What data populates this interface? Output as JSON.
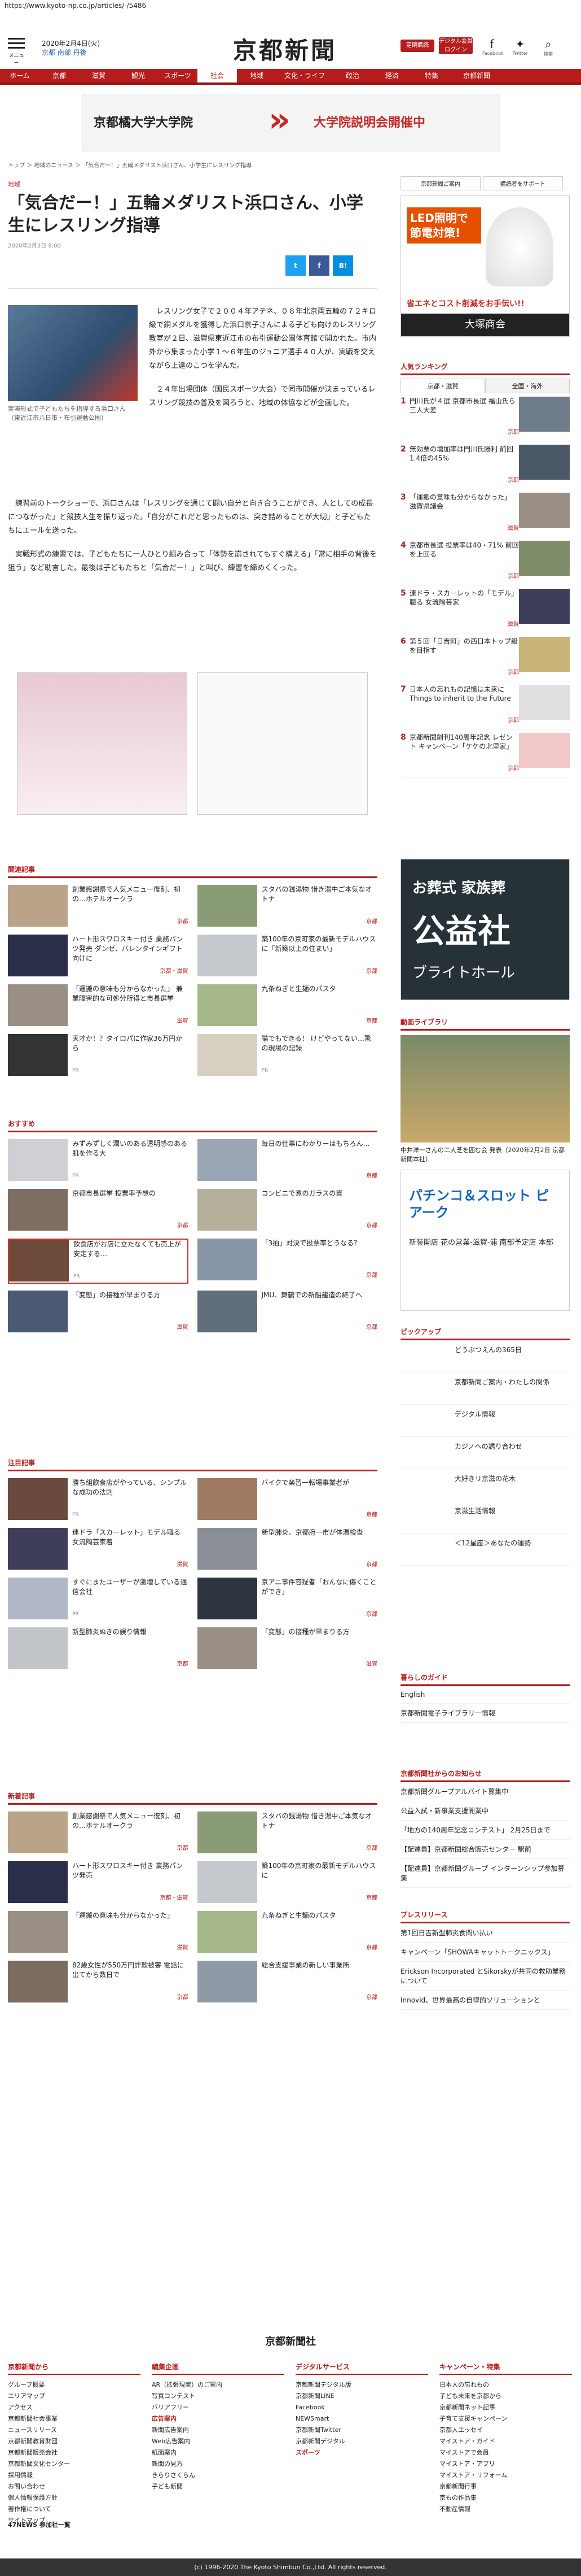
{
  "url": "https://www.kyoto-np.co.jp/articles/-/5486",
  "header": {
    "menu_label": "メニュー",
    "date": "2020年2月4日(火)",
    "weather_cities": [
      "京都",
      "南部",
      "丹後"
    ],
    "logo": "京都新聞",
    "buttons": [
      "定期購読",
      "デジタル会員ログイン"
    ],
    "social": [
      "Facebook",
      "Twitter",
      "検索"
    ]
  },
  "nav": [
    "ホーム",
    "京都",
    "滋賀",
    "観光",
    "スポーツ",
    "社会",
    "地域",
    "文化・ライフ",
    "政治",
    "経済",
    "特集",
    "京都新聞"
  ],
  "nav_active": "社会",
  "banner": {
    "left": "京都橘大学大学院",
    "right": "大学院説明会開催中"
  },
  "breadcrumb": "トップ ＞ 地域のニュース ＞ 「気合だー！」五輪メダリスト浜口さん、小学生にレスリング指導",
  "article": {
    "category": "地域",
    "title": "「気合だー！」五輪メダリスト浜口さん、小学生にレスリング指導",
    "date": "2020年2月3日 8:00",
    "share": [
      "t",
      "f",
      "B!"
    ],
    "caption": "実演形式で子どもたちを指導する浜口さん（東近江市八日市・布引運動公園）",
    "paragraphs": [
      "レスリング女子で２００４年アテネ、０８年北京両五輪の７２キロ級で銅メダルを獲得した浜口京子さんによる子ども向けのレスリング教室が２日、滋賀県東近江市の布引運動公園体育館で開かれた。市内外から集まった小学１～６年生のジュニア選手４０人が、実戦を交えながら上達のこつを学んだ。",
      "２４年出場団体（国民スポーツ大会）で同市開催が決まっているレスリング競技の普及を図ろうと、地域の体協などが企画した。",
      "練習前のトークショーで、浜口さんは「レスリングを通じて闘い自分と向き合うことができ、人としての成長につながった」と競技人生を振り返った。「自分がこれだと思ったものは、突き詰めることが大切」と子どもたちにエールを送った。",
      "実戦形式の練習では、子どもたちに一人ひとり組み合って「体勢を崩されてもすぐ構える」「常に相手の背後を狙う」など助言した。最後は子どもたちと「気合だー！」と叫び、練習を締めくくった。"
    ]
  },
  "sections": {
    "related": {
      "title": "関連記事",
      "items": [
        {
          "text": "創業感謝祭で人気メニュー復刻、初の…ホテルオークラ",
          "tag": "京都"
        },
        {
          "text": "スタバの銭湯物 惜き湯中ご本気なオトナ",
          "tag": "京都"
        },
        {
          "text": "ハート形スワロスキー付き 業務パンツ発売 ダンゼ、バレンタインギフト向けに",
          "tag": "京都・滋賀"
        },
        {
          "text": "築100年の京町家の最新モデルハウスに「新築以上の住まい」",
          "tag": "京都"
        },
        {
          "text": "「運搬の意味も分からなかった」 兼業障害的な可処分所得と市長選挙",
          "tag": "滋賀"
        },
        {
          "text": "九条ねぎと生麺のパスタ",
          "tag": "京都"
        },
        {
          "text": "天才か！？タイロパに作家36万円から",
          "tag": "PR"
        },
        {
          "text": "猫でもできる！ けどやってない…驚の現場の記録",
          "tag": "PR"
        }
      ]
    },
    "recommended": {
      "title": "おすすめ",
      "items": [
        {
          "text": "みずみずしく潤いのある透明感のある肌を作る大",
          "tag": "PR"
        },
        {
          "text": "毎日の仕事にわかりーはもちろん…",
          "tag": "京都"
        },
        {
          "text": "京都市長選挙 投票率予想の",
          "tag": "京都"
        },
        {
          "text": "コンビニで煮のガラスの資",
          "tag": "京都"
        },
        {
          "text": "飲食店がお店に立たなくても売上が安定する…",
          "tag": "PR"
        },
        {
          "text": "「3拍」対決で投票率どうなる？",
          "tag": "京都"
        },
        {
          "text": "「変態」の接種が早まりる方",
          "tag": "滋賀"
        },
        {
          "text": "JMU、舞鶴での新船建造の終了へ",
          "tag": "京都"
        }
      ]
    },
    "featured": {
      "title": "注目記事",
      "items": [
        {
          "text": "勝ち組飲食店がやっている、シンプルな成功の法則",
          "tag": "PR"
        },
        {
          "text": "バイクで楽習一転場事業者が",
          "tag": "京都"
        },
        {
          "text": "連ドラ「スカーレット」モデル職る 女流陶芸家着",
          "tag": "滋賀"
        },
        {
          "text": "新型肺炎、京都府一市が体温検査",
          "tag": "京都"
        },
        {
          "text": "すぐにまたユーザーが激増している通信会社",
          "tag": "PR"
        },
        {
          "text": "京アニ事件容疑者「おんなに傷くことができ」",
          "tag": "京都"
        },
        {
          "text": "新型肺炎ぬきの誤り情報",
          "tag": "京都"
        },
        {
          "text": "「変態」の接種が早まりる方",
          "tag": "滋賀"
        }
      ]
    },
    "latest": {
      "title": "新着記事",
      "items": [
        {
          "text": "創業感謝祭で人気メニュー復刻、初の…ホテルオークラ",
          "tag": "京都"
        },
        {
          "text": "スタバの銭湯物 惜き湯中ご本気なオトナ",
          "tag": "京都"
        },
        {
          "text": "ハート形スワロスキー付き 業務パンツ発売",
          "tag": "京都・滋賀"
        },
        {
          "text": "築100年の京町家の最新モデルハウスに",
          "tag": "京都"
        },
        {
          "text": "「運搬の意味も分からなかった」",
          "tag": "滋賀"
        },
        {
          "text": "九条ねぎと生麺のパスタ",
          "tag": "京都"
        },
        {
          "text": "82歳女性が550万円詐欺被害 電話に出てから数日で",
          "tag": "京都"
        },
        {
          "text": "総合支援事業の新しい事業所",
          "tag": "京都"
        }
      ]
    }
  },
  "sidebar": {
    "links": [
      "京都新聞ご案内",
      "購読者をサポート"
    ],
    "ad1": {
      "line1": "LED照明で節電対策!",
      "line2": "省エネとコスト削減をお手伝い!!",
      "brand": "大塚商会"
    },
    "ranking": {
      "title": "人気ランキング",
      "tabs": [
        "京都・滋賀",
        "全国・海外"
      ],
      "items": [
        {
          "n": "1",
          "text": "門川氏が４選 京都市長選 福山氏ら三人大差",
          "tag": "京都"
        },
        {
          "n": "2",
          "text": "無効票の増加率は門川氏勝利 前回1.4倍の45%",
          "tag": "京都"
        },
        {
          "text": "「運搬の意味も分からなかった」 滋賀県議会",
          "n": "3",
          "tag": "滋賀"
        },
        {
          "n": "4",
          "text": "京都市長選 投票率は40・71% 前回を上回る",
          "tag": "京都"
        },
        {
          "n": "5",
          "text": "連ドラ・スカーレットの「モデル」職る 女流陶芸家",
          "tag": "滋賀"
        },
        {
          "n": "6",
          "text": "第５回「日吉町」の西日本トップ級を目指す",
          "tag": "京都"
        },
        {
          "n": "7",
          "text": "日本人の忘れもの記憶は未来に Things to inherit to the Future",
          "tag": "京都"
        },
        {
          "n": "8",
          "text": "京都新聞創刊140周年記念 レゼント キャンペーン「ケケの北里家」",
          "tag": "京都"
        }
      ]
    },
    "ad2": {
      "line1": "お葬式 家族葬",
      "line2": "公益社",
      "line3": "ブライトホール"
    },
    "video": {
      "title": "動画ライブラリ",
      "caption": "中井洋一さんの二大芝を囲む会 発表（2020年2月2日 京都新聞本社）"
    },
    "ad3": {
      "line1": "パチンコ＆スロット ピアーク",
      "line2": "新装開店 花の営業-滋賀-浦 南部予定店 本部"
    },
    "pickup": {
      "title": "ピックアップ",
      "items": [
        "どうぶつえんの365日",
        "京都新聞ご案内・わたしの関係",
        "デジタル情報",
        "カジノへの誘り合わせ",
        "大好きリ京滋の花木",
        "京滋生活情報",
        "＜12星座＞あなたの運勢"
      ]
    },
    "life": {
      "title": "暮らしのガイド",
      "items": [
        "English",
        "京都新聞電子ライブラリー情報"
      ]
    },
    "notice": {
      "title": "京都新聞社からのお知らせ",
      "items": [
        "京都新聞グループアルバイト募集中",
        "公益入試・新事業支援開業中",
        "「地方の140周年記念コンテスト」 2月25日まで",
        "【配達員】京都新聞総合販売センター 駅前",
        "【配達員】京都新聞グループ インターンシップ参加募集"
      ]
    },
    "press": {
      "title": "プレスリリース",
      "items": [
        "第1回日吉新型肺炎食問い払い",
        "キャンペーン「SHOWAキャットトークニックス」",
        "Erickson Incorporated とSikorskyが共同の救助業務について",
        "Innovid、世界最高の自律的ソリューションと"
      ]
    }
  },
  "footer": {
    "logo": "京都新聞社",
    "columns": [
      {
        "title": "京都新聞から",
        "items": [
          "グループ概要",
          "エリアマップ",
          "アクセス",
          "京都新聞社会事業",
          "ニュースリリース",
          "京都新聞教育財団",
          "京都新聞販売会社",
          "京都新聞文化センター",
          "採用情報",
          "お問い合わせ",
          "個人情報保護方針",
          "著作権について",
          "サイトマップ"
        ]
      },
      {
        "title": "編集企画",
        "items": [
          "AR（拡張現実）のご案内",
          "写真コンテスト",
          "バリアフリー",
          "広告案内",
          "新聞広告案内",
          "Web広告案内",
          "紙面案内",
          "新聞の見方",
          "きらりさくらん",
          "子ども新聞"
        ]
      },
      {
        "title": "デジタルサービス",
        "items": [
          "京都新聞デジタル版",
          "京都新聞LINE",
          "Facebook",
          "NEWSmart",
          "京都新聞Twitter",
          "京都新聞デジタル",
          "スポーツ"
        ]
      },
      {
        "title": "キャンペーン・特集",
        "items": [
          "日本人の忘れもの",
          "子ども未来を京都から",
          "京都新聞ネット記事",
          "子育て支援キャンペーン",
          "京都人エッセイ",
          "マイストア・ガイド",
          "マイストアで会員",
          "マイストア・アプリ",
          "マイストア・リフォーム",
          "京都新聞行事",
          "京もの作品集",
          "不動産情報"
        ]
      }
    ],
    "partners_title": "47NEWS 参加社一覧",
    "copyright": "(c) 1996-2020 The Kyoto Shimbun Co.,Ltd. All rights reserved."
  },
  "colors": {
    "brand": "#b71c1c",
    "text": "#222222"
  }
}
